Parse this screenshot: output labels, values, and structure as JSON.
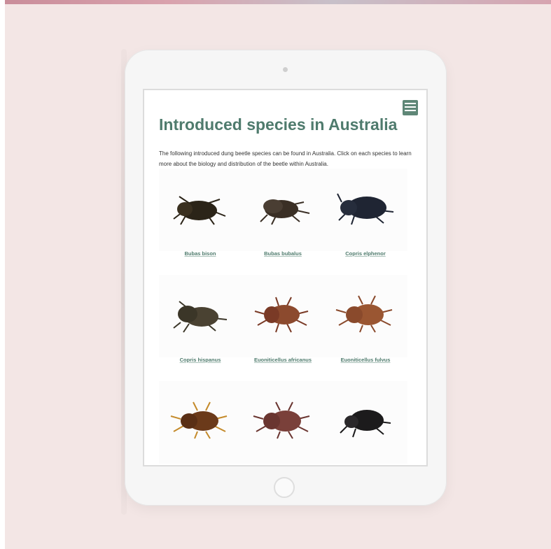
{
  "page": {
    "title": "Introduced species in Australia",
    "intro": "The following introduced dung beetle species can be found in Australia. Click on each species to learn more about the biology and distribution of the beetle within Australia."
  },
  "species": [
    {
      "name": "Bubas bison",
      "color": "#2b2418",
      "icon": "beetle-photo"
    },
    {
      "name": "Bubas bubalus",
      "color": "#3a2f25",
      "icon": "beetle-photo"
    },
    {
      "name": "Copris elphenor",
      "color": "#1f2533",
      "icon": "beetle-photo"
    },
    {
      "name": "Copris hispanus",
      "color": "#3b3628",
      "icon": "beetle-photo"
    },
    {
      "name": "Euoniticellus africanus",
      "color": "#7a3a26",
      "icon": "beetle-photo"
    },
    {
      "name": "Euoniticellus fulvus",
      "color": "#8a4a2c",
      "icon": "beetle-photo"
    },
    {
      "name": "",
      "color": "#6b3a1a",
      "icon": "beetle-photo"
    },
    {
      "name": "",
      "color": "#6a3530",
      "icon": "beetle-photo"
    },
    {
      "name": "",
      "color": "#1c1b1c",
      "icon": "beetle-photo"
    }
  ],
  "colors": {
    "background": "#f3e6e5",
    "accent": "#4f7b6d",
    "menu": "#5f8777"
  },
  "icons": {
    "menu": "hamburger-menu-icon",
    "home": "home-button-icon"
  }
}
